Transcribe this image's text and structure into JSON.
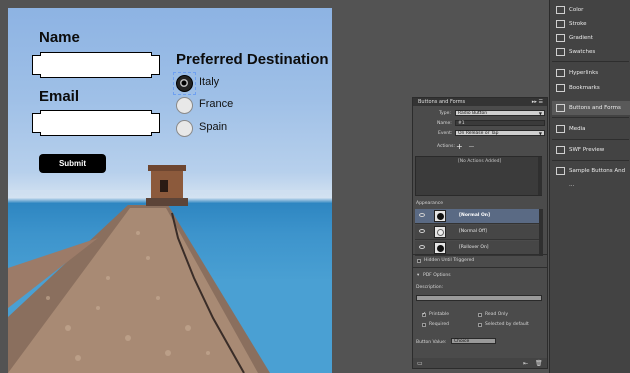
{
  "form": {
    "name_label": "Name",
    "email_label": "Email",
    "destination_label": "Preferred Destination",
    "submit_label": "Submit",
    "options": [
      "Italy",
      "France",
      "Spain"
    ],
    "selected_option": "Italy"
  },
  "dock": {
    "items": [
      {
        "label": "Color",
        "icon": "color-icon"
      },
      {
        "label": "Stroke",
        "icon": "stroke-icon"
      },
      {
        "label": "Gradient",
        "icon": "gradient-icon"
      },
      {
        "label": "Swatches",
        "icon": "swatches-icon"
      },
      {
        "label": "Hyperlinks",
        "icon": "hyperlinks-icon"
      },
      {
        "label": "Bookmarks",
        "icon": "bookmarks-icon"
      },
      {
        "label": "Buttons and Forms",
        "icon": "buttons-forms-icon",
        "active": true
      },
      {
        "label": "Media",
        "icon": "media-icon"
      },
      {
        "label": "SWF Preview",
        "icon": "swf-preview-icon"
      },
      {
        "label": "Sample Buttons And ...",
        "icon": "sample-buttons-icon"
      }
    ]
  },
  "panel": {
    "title": "Buttons and Forms",
    "type_label": "Type:",
    "type_value": "Radio Button",
    "name_label": "Name:",
    "name_value": "#1",
    "event_label": "Event:",
    "event_value": "On Release or Tap",
    "actions_label": "Actions:",
    "actions_empty": "[No Actions Added]",
    "appearance_label": "Appearance",
    "appearance_states": [
      "[Normal On]",
      "[Normal Off]",
      "[Rollover On]"
    ],
    "hidden_label": "Hidden Until Triggered",
    "pdf_options_label": "PDF Options",
    "description_label": "Description:",
    "printable_label": "Printable",
    "read_only_label": "Read Only",
    "required_label": "Required",
    "selected_default_label": "Selected by default",
    "button_value_label": "Button Value:",
    "button_value": "Choice"
  },
  "colors": {
    "ui_background": "#535353",
    "panel_background": "#4b4b4b",
    "selection": "#5a6a84"
  }
}
